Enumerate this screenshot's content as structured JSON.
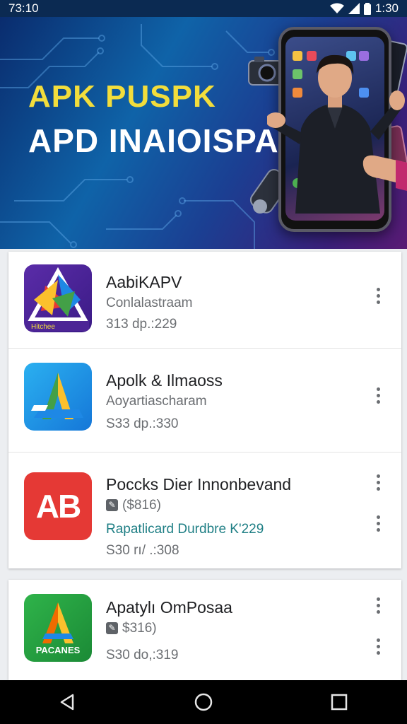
{
  "status_bar": {
    "left_time": "73:10",
    "right_time": "1:30"
  },
  "banner": {
    "line1": "APK PUSPK",
    "line2": "APD INAIOISPA"
  },
  "apps": [
    {
      "title": "AabiKAPV",
      "subtitle": "Conlalastraam",
      "meta": "313 dp.:229",
      "icon_label": "Hitchee",
      "icon_text": ""
    },
    {
      "title": "Apolk & Ilmaoss",
      "subtitle": "Aoyartiascharam",
      "meta": "S33 dp.:330",
      "icon_text": "A"
    },
    {
      "title": "Poccks Dier Innonbevand",
      "price": "($816)",
      "link": "Rapatlicard Durdbre K'229",
      "meta": "S30 rı/ .:308",
      "icon_text": "AB"
    },
    {
      "title": "Apatylı OmPosaa",
      "price": "$316)",
      "meta": "S30 do,:319",
      "icon_label": "PACANES",
      "icon_text": "A"
    }
  ],
  "colors": {
    "accent_teal": "#1f7f85",
    "banner_yellow": "#f2dd3c",
    "nav_bg": "#000000"
  },
  "icons": {
    "status": [
      "wifi-icon",
      "signal-icon",
      "battery-icon"
    ],
    "nav": [
      "back-icon",
      "home-icon",
      "recents-icon"
    ],
    "row_menu": "more-vert-icon"
  }
}
